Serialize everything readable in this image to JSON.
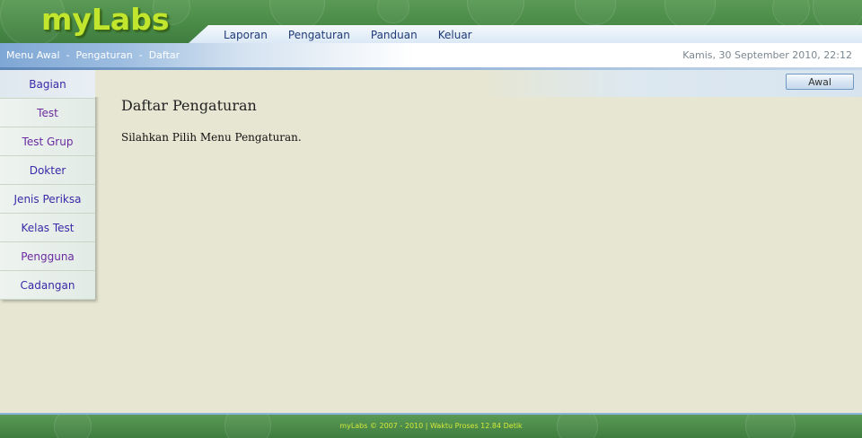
{
  "app": {
    "logo_text": "myLabs"
  },
  "nav": {
    "items": [
      "Laporan",
      "Pengaturan",
      "Panduan",
      "Keluar"
    ]
  },
  "breadcrumb": {
    "text": "Menu Awal  -  Pengaturan  -  Daftar"
  },
  "datetime": "Kamis, 30 September 2010, 22:12",
  "sidebar": {
    "items": [
      {
        "label": "Bagian"
      },
      {
        "label": "Test"
      },
      {
        "label": "Test Grup"
      },
      {
        "label": "Dokter"
      },
      {
        "label": "Jenis Periksa"
      },
      {
        "label": "Kelas Test"
      },
      {
        "label": "Pengguna"
      },
      {
        "label": "Cadangan"
      }
    ]
  },
  "toolbar": {
    "awal_label": "Awal"
  },
  "main": {
    "title": "Daftar Pengaturan",
    "text": "Silahkan Pilih Menu Pengaturan."
  },
  "footer": {
    "text": "myLabs © 2007 - 2010  |  Waktu Proses 12.84 Detik"
  },
  "colors": {
    "header_green": "#4a8b48",
    "logo_lime": "#c2e62e",
    "link_blue": "#1f3b78",
    "sidebar_link": "#3a29a8",
    "footer_text": "#d4e83a"
  }
}
